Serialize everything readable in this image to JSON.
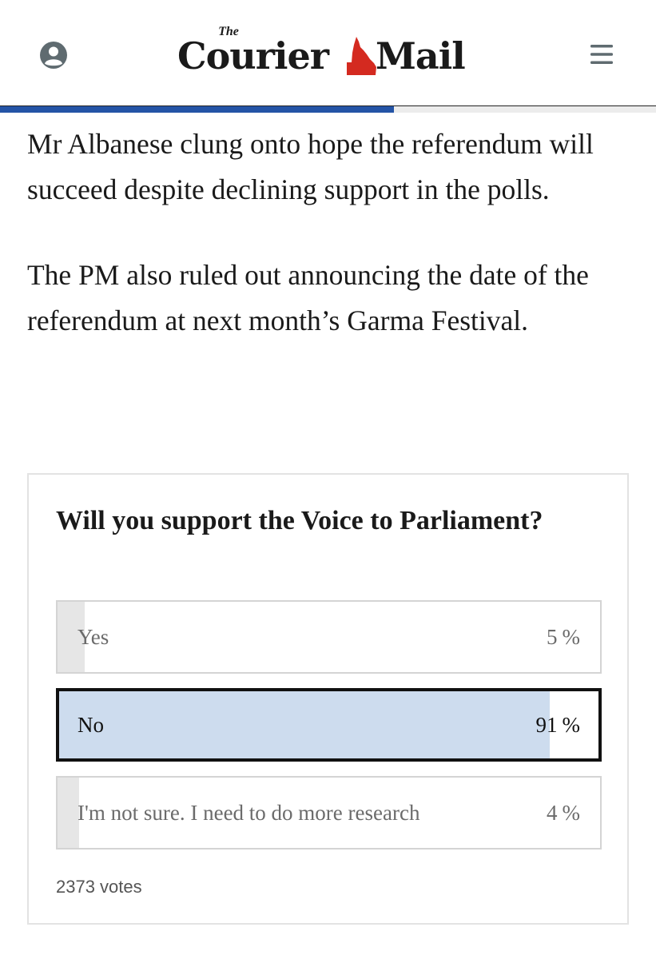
{
  "header": {
    "logo": {
      "the": "The",
      "word_left": "Courier",
      "word_right": "Mail"
    },
    "icons": {
      "account": "account-circle-icon",
      "menu": "hamburger-menu-icon"
    }
  },
  "reading_progress": {
    "fraction": 0.6
  },
  "colors": {
    "accent_blue": "#2454a6",
    "logo_red": "#d42a20",
    "selected_fill": "#cddcee",
    "unselected_fill": "#e6e6e6"
  },
  "article": {
    "paragraphs": [
      "Mr Albanese clung onto hope the referendum will succeed despite declining support in the polls.",
      "The PM also ruled out announcing the date of the referendum at next month’s Garma Festival."
    ]
  },
  "poll": {
    "question": "Will you support the Voice to Parliament?",
    "options": [
      {
        "label": "Yes",
        "percent": 5,
        "percent_text": "5",
        "selected": false
      },
      {
        "label": "No",
        "percent": 91,
        "percent_text": "91",
        "selected": true
      },
      {
        "label": "I'm not sure. I need to do more research",
        "percent": 4,
        "percent_text": "4",
        "selected": false
      }
    ],
    "percent_sign": "%",
    "votes_text": "2373 votes"
  }
}
